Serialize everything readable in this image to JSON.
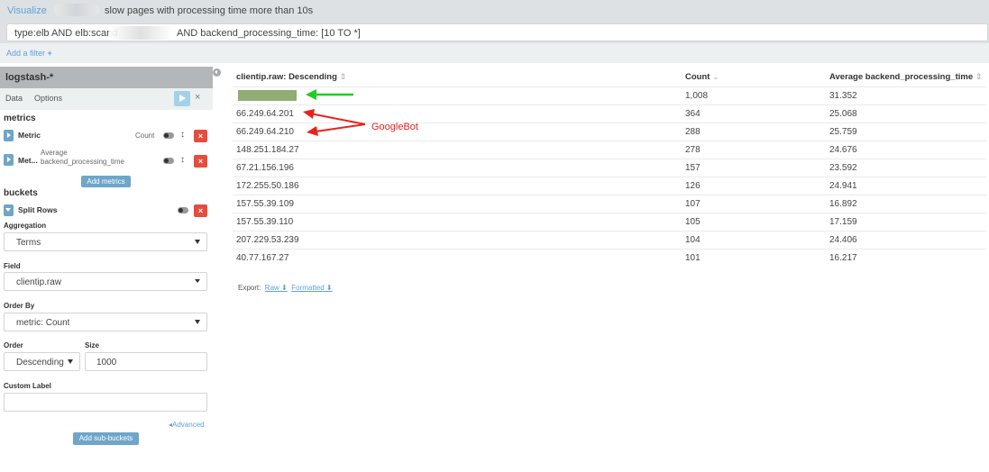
{
  "breadcrumb": {
    "link": "Visualize",
    "title": "slow pages with processing time more than 10s"
  },
  "query": {
    "prefix": "type:elb AND elb:scand",
    "suffix": "AND backend_processing_time: [10 TO *]"
  },
  "filter": {
    "add_label": "Add a filter",
    "plus": "+"
  },
  "sidebar": {
    "index_pattern": "logstash-*",
    "tabs": [
      "Data",
      "Options"
    ],
    "discard": "×",
    "metrics_title": "metrics",
    "metrics": [
      {
        "label": "Metric",
        "desc": "Count"
      },
      {
        "label": "Met...",
        "desc_line1": "Average",
        "desc_line2": "backend_processing_time"
      }
    ],
    "add_metrics": "Add metrics",
    "buckets_title": "buckets",
    "bucket": {
      "label": "Split Rows"
    },
    "aggregation": {
      "label": "Aggregation",
      "value": "Terms"
    },
    "field": {
      "label": "Field",
      "value": "clientip.raw"
    },
    "order_by": {
      "label": "Order By",
      "value": "metric: Count"
    },
    "order": {
      "label": "Order",
      "value": "Descending"
    },
    "size": {
      "label": "Size",
      "value": "1000"
    },
    "custom_label": {
      "label": "Custom Label",
      "value": ""
    },
    "advanced": "Advanced",
    "add_sub_buckets": "Add sub-buckets",
    "remove_symbol": "×",
    "sort_symbol": "↕"
  },
  "table": {
    "columns": [
      {
        "label": "clientip.raw: Descending",
        "sort": "⇕"
      },
      {
        "label": "Count",
        "sort": "⌄"
      },
      {
        "label": "Average backend_processing_time",
        "sort": "⇕"
      }
    ],
    "rows": [
      {
        "ip": "",
        "count": "1,008",
        "avg": "31.352",
        "redacted": true
      },
      {
        "ip": "66.249.64.201",
        "count": "364",
        "avg": "25.068"
      },
      {
        "ip": "66.249.64.210",
        "count": "288",
        "avg": "25.759"
      },
      {
        "ip": "148.251.184.27",
        "count": "278",
        "avg": "24.676"
      },
      {
        "ip": "67.21.156.196",
        "count": "157",
        "avg": "23.592"
      },
      {
        "ip": "172.255.50.186",
        "count": "126",
        "avg": "24.941"
      },
      {
        "ip": "157.55.39.109",
        "count": "107",
        "avg": "16.892"
      },
      {
        "ip": "157.55.39.110",
        "count": "105",
        "avg": "17.159"
      },
      {
        "ip": "207.229.53.239",
        "count": "104",
        "avg": "24.406"
      },
      {
        "ip": "40.77.167.27",
        "count": "101",
        "avg": "16.217"
      }
    ],
    "export": {
      "label": "Export:",
      "raw": "Raw",
      "formatted": "Formatted"
    }
  },
  "annotation": {
    "label": "GoogleBot",
    "colors": {
      "red": "#e8221c",
      "green": "#22cc22"
    }
  },
  "colors": {
    "link": "#5fa2dd",
    "header_bar": "#dde1e3",
    "button": "#6ea5c8",
    "danger": "#e74c3c",
    "redaction": "#8fad74"
  }
}
